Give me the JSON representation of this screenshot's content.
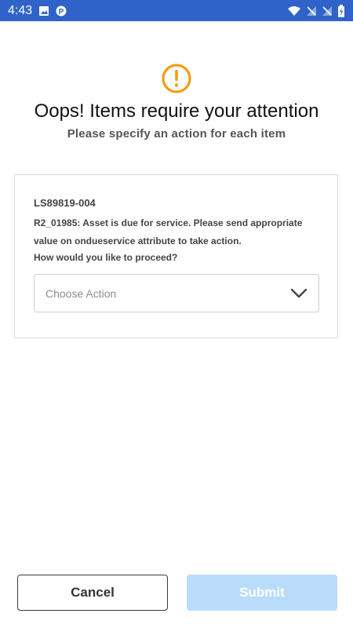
{
  "status_bar": {
    "time": "4:43",
    "left_icons": [
      "image-icon",
      "parking-icon"
    ],
    "right_icons": [
      "wifi-icon",
      "signal-icon",
      "signal-icon",
      "battery-icon"
    ],
    "color": "#2f63c9"
  },
  "header": {
    "icon": "alert-circle-icon",
    "icon_color": "#f39c12",
    "title": "Oops! Items require your attention",
    "subtitle": "Please specify an action for each item"
  },
  "item": {
    "asset_id": "LS89819-004",
    "message": "R2_01985: Asset is due for service. Please send appropriate value on ondueservice attribute to take action.",
    "question": "How would you like to proceed?",
    "select": {
      "placeholder": "Choose Action"
    }
  },
  "footer": {
    "cancel_label": "Cancel",
    "submit_label": "Submit",
    "submit_color": "#b9dcfb"
  }
}
